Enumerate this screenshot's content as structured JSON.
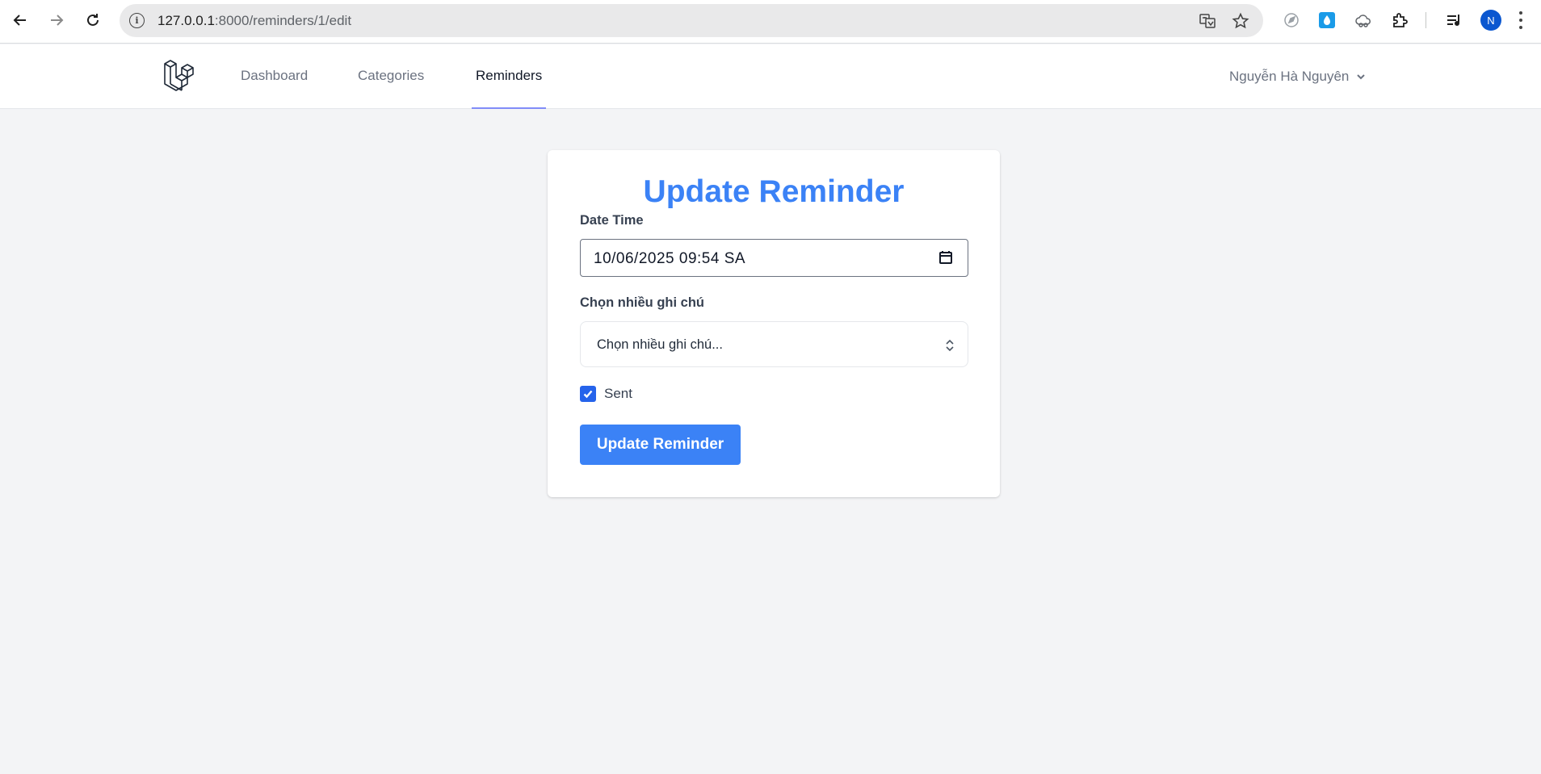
{
  "browser": {
    "url_host": "127.0.0.1",
    "url_rest": ":8000/reminders/1/edit",
    "profile_initial": "N",
    "icons": [
      "back-arrow-icon",
      "forward-arrow-icon",
      "reload-icon",
      "site-info-icon",
      "translate-icon",
      "bookmark-star-icon",
      "extension-compass-icon",
      "extension-drop-icon",
      "extension-cloud-icon",
      "extensions-puzzle-icon",
      "media-queue-icon",
      "more-menu-icon"
    ],
    "accent": "#0b57d0"
  },
  "nav": {
    "links": [
      {
        "label": "Dashboard"
      },
      {
        "label": "Categories"
      },
      {
        "label": "Reminders"
      }
    ],
    "active": "Reminders",
    "user_name": "Nguyễn Hà Nguyên"
  },
  "form": {
    "title": "Update Reminder",
    "datetime_label": "Date Time",
    "datetime_value": "10/06/2025 09:54 SA",
    "notes_label": "Chọn nhiều ghi chú",
    "notes_placeholder": "Chọn nhiều ghi chú...",
    "sent_label": "Sent",
    "sent_checked": true,
    "submit_label": "Update Reminder"
  },
  "colors": {
    "primary": "#3b82f6",
    "checkbox": "#2563eb",
    "active_tab_underline": "#818cf8",
    "background": "#f3f4f6"
  }
}
